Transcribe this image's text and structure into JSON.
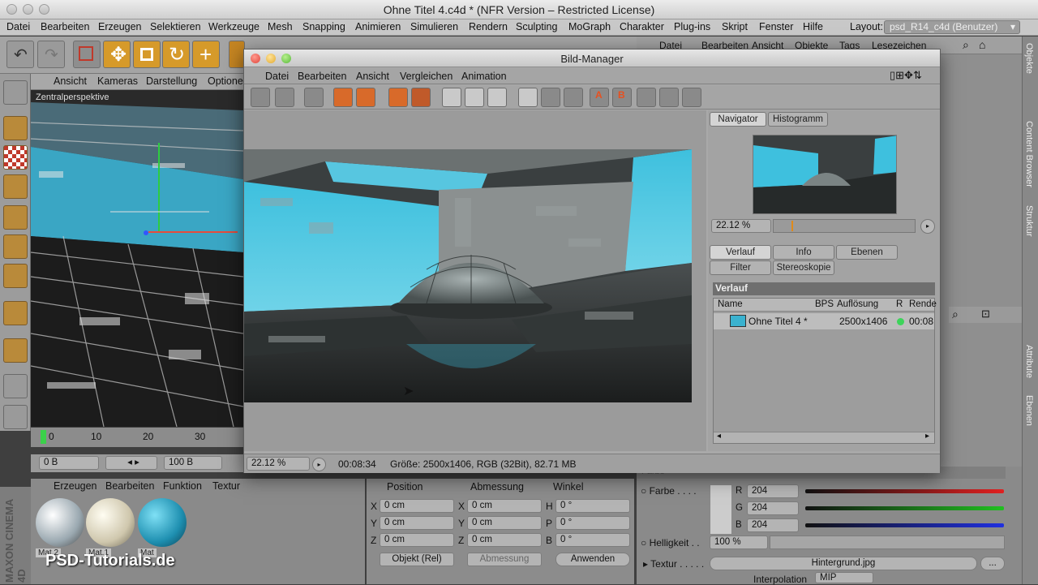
{
  "app": {
    "window_title": "Ohne Titel 4.c4d * (NFR Version – Restricted License)",
    "menu": [
      "Datei",
      "Bearbeiten",
      "Erzeugen",
      "Selektieren",
      "Werkzeuge",
      "Mesh",
      "Snapping",
      "Animieren",
      "Simulieren",
      "Rendern",
      "Sculpting",
      "MoGraph",
      "Charakter",
      "Plug-ins",
      "Skript",
      "Fenster",
      "Hilfe"
    ],
    "layout_label": "Layout:",
    "layout_value": "psd_R14_c4d (Benutzer)"
  },
  "right_menu": [
    "Datei",
    "Bearbeiten",
    "Ansicht",
    "Objekte",
    "Tags",
    "Lesezeichen"
  ],
  "right_tabs": [
    "Objekte",
    "Content Browser",
    "Struktur",
    "Attribute",
    "Ebenen"
  ],
  "viewport": {
    "menu": [
      "Ansicht",
      "Kameras",
      "Darstellung",
      "Optione"
    ],
    "label": "Zentralperspektive"
  },
  "timeline": {
    "ticks": [
      "0",
      "10",
      "20",
      "30"
    ]
  },
  "transport": {
    "start": "0 B",
    "end": "100 B"
  },
  "materials": {
    "menu": [
      "Erzeugen",
      "Bearbeiten",
      "Funktion",
      "Textur"
    ],
    "items": [
      {
        "label": "Mat.2",
        "color": "#c8d4dc"
      },
      {
        "label": "Mat.1",
        "color": "#d8d2bd"
      },
      {
        "label": "Mat",
        "color": "#1e8fb0"
      }
    ]
  },
  "brand": {
    "logo": "PSD-Tutorials.de",
    "maxon": "MAXON CINEMA 4D"
  },
  "coordinates": {
    "headers": [
      "Position",
      "Abmessung",
      "Winkel"
    ],
    "rows": [
      {
        "axis": "X",
        "pos": "0 cm",
        "dim_axis": "X",
        "dim": "0 cm",
        "ang_axis": "H",
        "ang": "0 °"
      },
      {
        "axis": "Y",
        "pos": "0 cm",
        "dim_axis": "Y",
        "dim": "0 cm",
        "ang_axis": "P",
        "ang": "0 °"
      },
      {
        "axis": "Z",
        "pos": "0 cm",
        "dim_axis": "Z",
        "dim": "0 cm",
        "ang_axis": "B",
        "ang": "0 °"
      }
    ],
    "mode": "Objekt (Rel)",
    "size_mode": "Abmessung",
    "apply": "Anwenden"
  },
  "attributes": {
    "section": "Farbe",
    "farbe_label": "Farbe . . . .",
    "r_label": "R",
    "r_value": "204",
    "g_label": "G",
    "g_value": "204",
    "b_label": "B",
    "b_value": "204",
    "helligkeit_label": "Helligkeit . .",
    "helligkeit_value": "100 %",
    "textur_label": "Textur . . . . .",
    "textur_value": "Hintergrund.jpg",
    "textur_more": "...",
    "interp_label": "Interpolation",
    "interp_value": "MIP"
  },
  "bild_manager": {
    "title": "Bild-Manager",
    "menu": [
      "Datei",
      "Bearbeiten",
      "Ansicht",
      "Vergleichen",
      "Animation"
    ],
    "nav_tabs": [
      "Navigator",
      "Histogramm"
    ],
    "zoom": "22.12 %",
    "info_tabs": [
      "Verlauf",
      "Info",
      "Ebenen"
    ],
    "info_tabs2": [
      "Filter",
      "Stereoskopie"
    ],
    "history_title": "Verlauf",
    "columns": [
      "Name",
      "BPS",
      "Auflösung",
      "R",
      "Rende"
    ],
    "rows": [
      {
        "name": "Ohne Titel 4 *",
        "bps": "",
        "resolution": "2500x1406",
        "time": "00:08"
      }
    ],
    "status_zoom": "22.12 %",
    "status_time": "00:08:34",
    "status_info": "Größe: 2500x1406, RGB (32Bit), 82.71 MB"
  }
}
